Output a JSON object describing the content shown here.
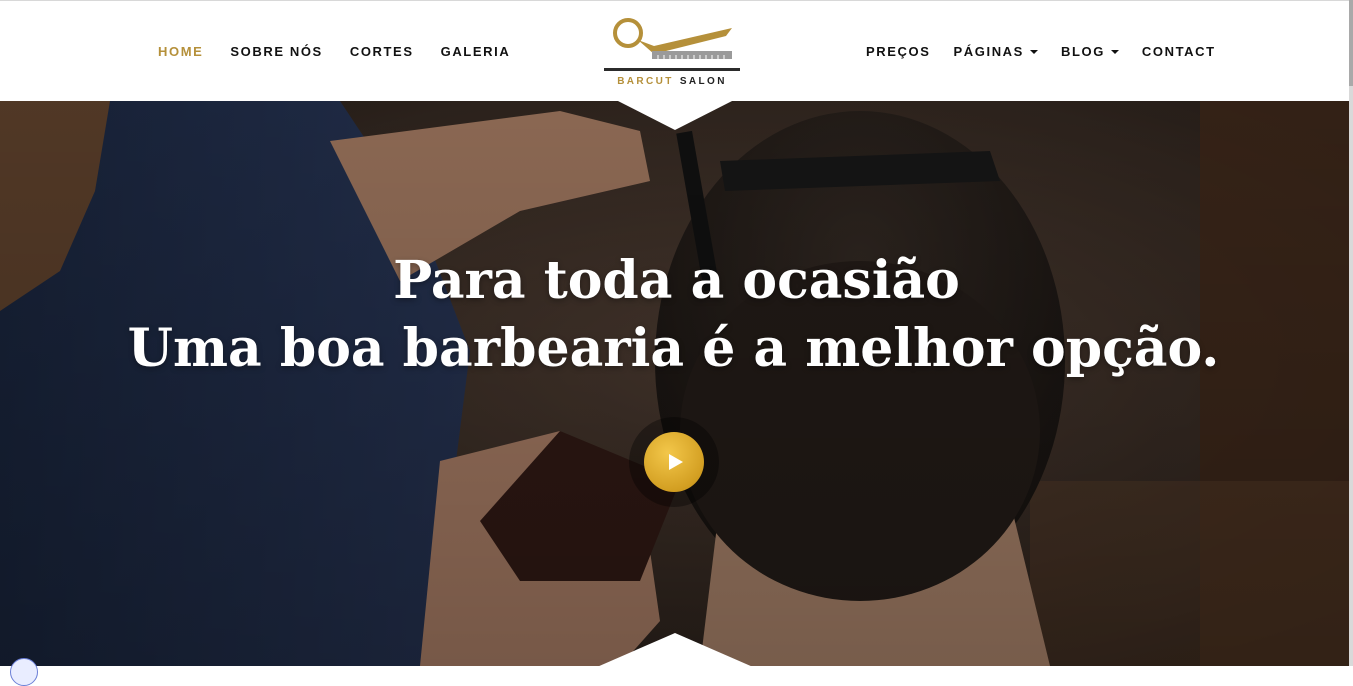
{
  "nav": {
    "left": [
      {
        "label": "HOME",
        "active": true
      },
      {
        "label": "SOBRE NÓS",
        "active": false
      },
      {
        "label": "CORTES",
        "active": false
      },
      {
        "label": "GALERIA",
        "active": false
      }
    ],
    "right": [
      {
        "label": "PREÇOS",
        "has_dropdown": false
      },
      {
        "label": "PÁGINAS",
        "has_dropdown": true
      },
      {
        "label": "BLOG",
        "has_dropdown": true
      },
      {
        "label": "CONTACT",
        "has_dropdown": false
      }
    ]
  },
  "logo": {
    "word1": "BARCUT",
    "word2": "SALON",
    "icon": "scissors-comb-icon"
  },
  "hero": {
    "line1": "Para toda a ocasião",
    "line2": "Uma boa barbearia é a melhor opção.",
    "play_icon": "play-icon"
  },
  "colors": {
    "accent": "#b5903a",
    "nav_text": "#111111",
    "play_button": "#d9a628",
    "hero_text": "#ffffff"
  }
}
